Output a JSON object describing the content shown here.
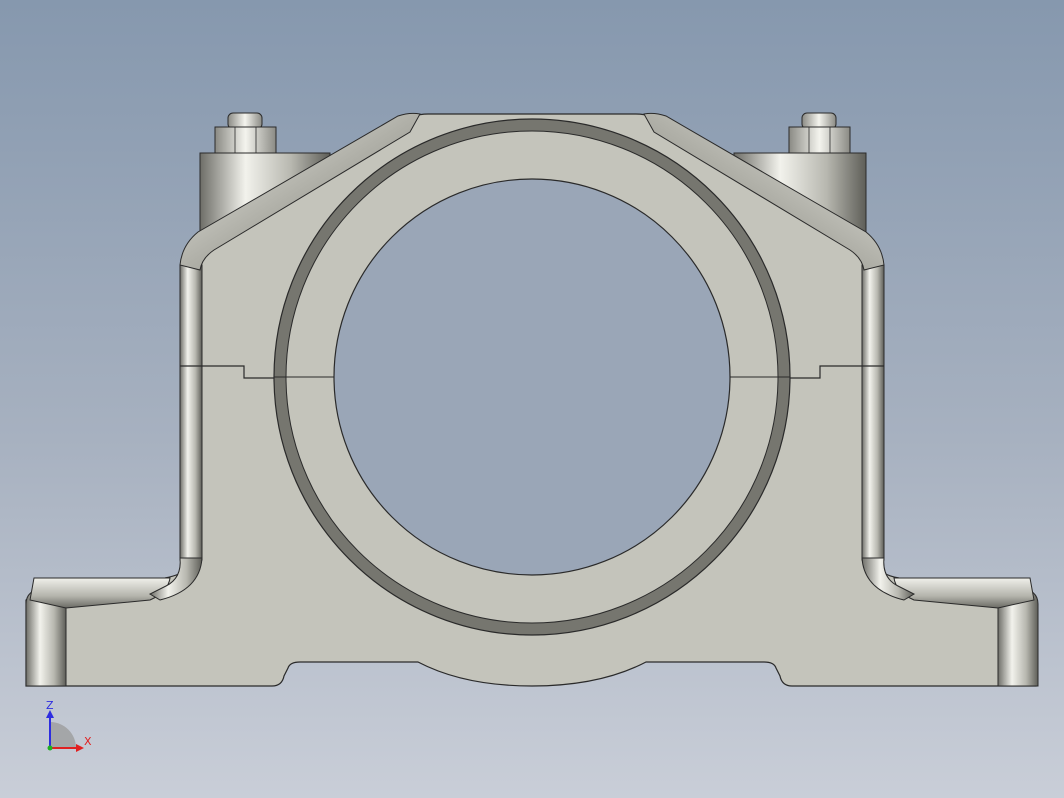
{
  "viewport": {
    "background_top": "#8698ae",
    "background_bottom": "#c9ced8"
  },
  "model": {
    "body_color": "#c4c4bb",
    "edge_color": "#2a2a2a",
    "ring_color": "#76766f"
  },
  "triad": {
    "z_label": "Z",
    "x_label": "X",
    "z_color": "#2d2de0",
    "x_color": "#e02020",
    "y_color": "#20b020"
  }
}
